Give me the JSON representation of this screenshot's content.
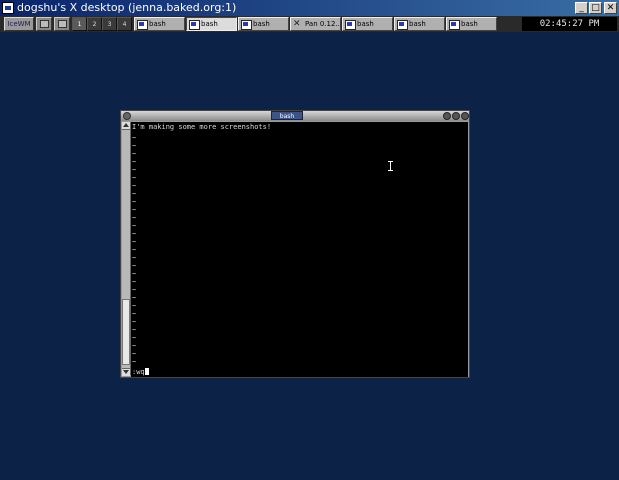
{
  "outer_window": {
    "title": "dogshu's X desktop (jenna.baked.org:1)",
    "minimize_symbol": "_",
    "maximize_symbol": "□",
    "close_symbol": "✕"
  },
  "taskbar": {
    "start_label": "IceWM",
    "workspaces": [
      "1",
      "2",
      "3",
      "4"
    ],
    "tasks": [
      {
        "label": "bash",
        "icon": "terminal-icon",
        "active": false
      },
      {
        "label": "bash",
        "icon": "terminal-icon",
        "active": true
      },
      {
        "label": "bash",
        "icon": "terminal-icon",
        "active": false
      },
      {
        "label": "Pan 0.12...",
        "icon": "x-icon",
        "active": false
      },
      {
        "label": "bash",
        "icon": "terminal-icon",
        "active": false
      },
      {
        "label": "bash",
        "icon": "terminal-icon",
        "active": false
      },
      {
        "label": "bash",
        "icon": "terminal-icon",
        "active": false
      }
    ],
    "clock": "02:45:27 PM"
  },
  "bash_window": {
    "title": "bash",
    "lines": [
      "I'm making some more screenshots!"
    ],
    "empty_line_marker": "~",
    "command_line": ":wq"
  }
}
